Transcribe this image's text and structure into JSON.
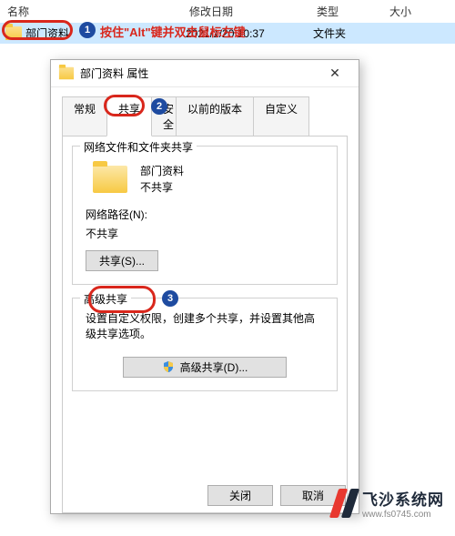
{
  "explorer": {
    "headers": {
      "name": "名称",
      "date": "修改日期",
      "type": "类型",
      "size": "大小"
    },
    "row": {
      "name": "部门资料",
      "date": "2021/1/20 10:37",
      "type": "文件夹"
    }
  },
  "annotations": {
    "step1": "按住\"Alt\"键并双击鼠标左键",
    "badge1": "1",
    "badge2": "2",
    "badge3": "3"
  },
  "dialog": {
    "title": "部门资料 属性",
    "tabs": {
      "general": "常规",
      "share": "共享",
      "security": "安全",
      "versions": "以前的版本",
      "custom": "自定义"
    },
    "share_group": {
      "title": "网络文件和文件夹共享",
      "folder_name": "部门资料",
      "share_state": "不共享",
      "path_label": "网络路径(N):",
      "path_value": "不共享",
      "share_btn": "共享(S)..."
    },
    "adv_group": {
      "title": "高级共享",
      "desc": "设置自定义权限，创建多个共享，并设置其他高级共享选项。",
      "adv_btn": "高级共享(D)..."
    },
    "buttons": {
      "close": "关闭",
      "cancel": "取消"
    }
  },
  "watermark": {
    "name": "飞沙系统网",
    "url": "www.fs0745.com"
  }
}
